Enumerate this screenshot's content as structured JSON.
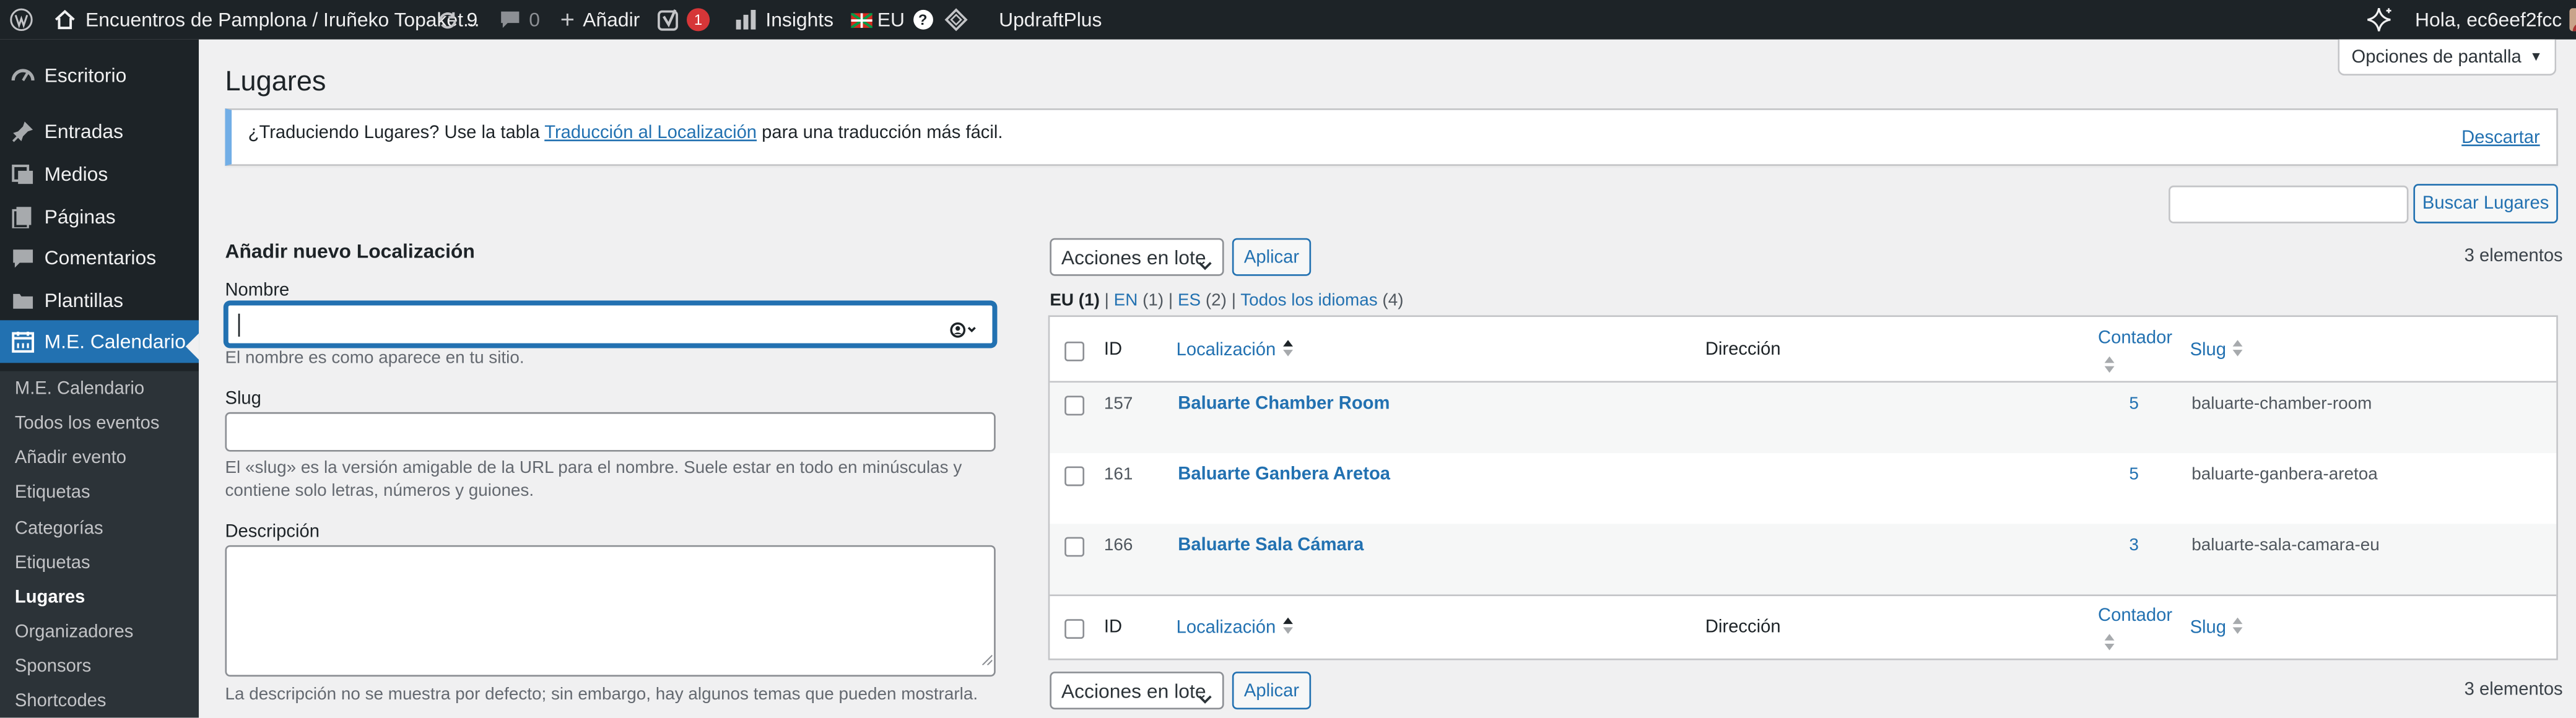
{
  "admin_bar": {
    "site_name": "Encuentros de Pamplona / Iruñeko Topaket...",
    "updates_count": "9",
    "comments_count": "0",
    "new_label": "Añadir",
    "yoast_count": "1",
    "insights_label": "Insights",
    "language_label": "EU",
    "updraft_label": "UpdraftPlus",
    "greeting": "Hola, ec6eef2fcc"
  },
  "sidebar": {
    "items": [
      {
        "label": "Escritorio",
        "icon": "dashboard-icon"
      },
      {
        "label": "Entradas",
        "icon": "pin-icon"
      },
      {
        "label": "Medios",
        "icon": "media-icon"
      },
      {
        "label": "Páginas",
        "icon": "pages-icon"
      },
      {
        "label": "Comentarios",
        "icon": "comments-icon"
      },
      {
        "label": "Plantillas",
        "icon": "folder-icon"
      },
      {
        "label": "M.E. Calendario",
        "icon": "calendar-icon"
      }
    ],
    "submenu": [
      "M.E. Calendario",
      "Todos los eventos",
      "Añadir evento",
      "Etiquetas",
      "Categorías",
      "Etiquetas",
      "Lugares",
      "Organizadores",
      "Sponsors",
      "Shortcodes"
    ]
  },
  "screen_options": "Opciones de pantalla",
  "page_title": "Lugares",
  "notice": {
    "text_before": "¿Traduciendo Lugares? Use la tabla ",
    "link": "Traducción al Localización",
    "text_after": " para una traducción más fácil.",
    "dismiss": "Descartar"
  },
  "search": {
    "value": "",
    "button": "Buscar Lugares"
  },
  "form": {
    "heading": "Añadir nuevo Localización",
    "name_label": "Nombre",
    "name_value": "",
    "name_hint": "El nombre es como aparece en tu sitio.",
    "slug_label": "Slug",
    "slug_value": "",
    "slug_hint_1": "El «slug» es la versión amigable de la URL para el nombre. Suele estar en todo en minúsculas y",
    "slug_hint_2": "contiene solo letras, números y guiones.",
    "desc_label": "Descripción",
    "desc_value": "",
    "desc_hint": "La descripción no se muestra por defecto; sin embargo, hay algunos temas que pueden mostrarla."
  },
  "bulk": {
    "select": "Acciones en lote",
    "apply": "Aplicar",
    "count": "3 elementos"
  },
  "lang_filters": {
    "eu": "EU",
    "eu_count": "(1)",
    "en": "EN",
    "en_count": "(1)",
    "es": "ES",
    "es_count": "(2)",
    "all": "Todos los idiomas",
    "all_count": "(4)",
    "sep": "|"
  },
  "table": {
    "headers": {
      "id": "ID",
      "name": "Localización",
      "address": "Dirección",
      "count": "Contador",
      "slug": "Slug"
    },
    "rows": [
      {
        "id": "157",
        "name": "Baluarte Chamber Room",
        "count": "5",
        "slug": "baluarte-chamber-room"
      },
      {
        "id": "161",
        "name": "Baluarte Ganbera Aretoa",
        "count": "5",
        "slug": "baluarte-ganbera-aretoa"
      },
      {
        "id": "166",
        "name": "Baluarte Sala Cámara",
        "count": "3",
        "slug": "baluarte-sala-camara-eu"
      }
    ]
  },
  "colors": {
    "accent": "#2271b1",
    "adminbar": "#1d2327",
    "badge": "#d63638"
  }
}
